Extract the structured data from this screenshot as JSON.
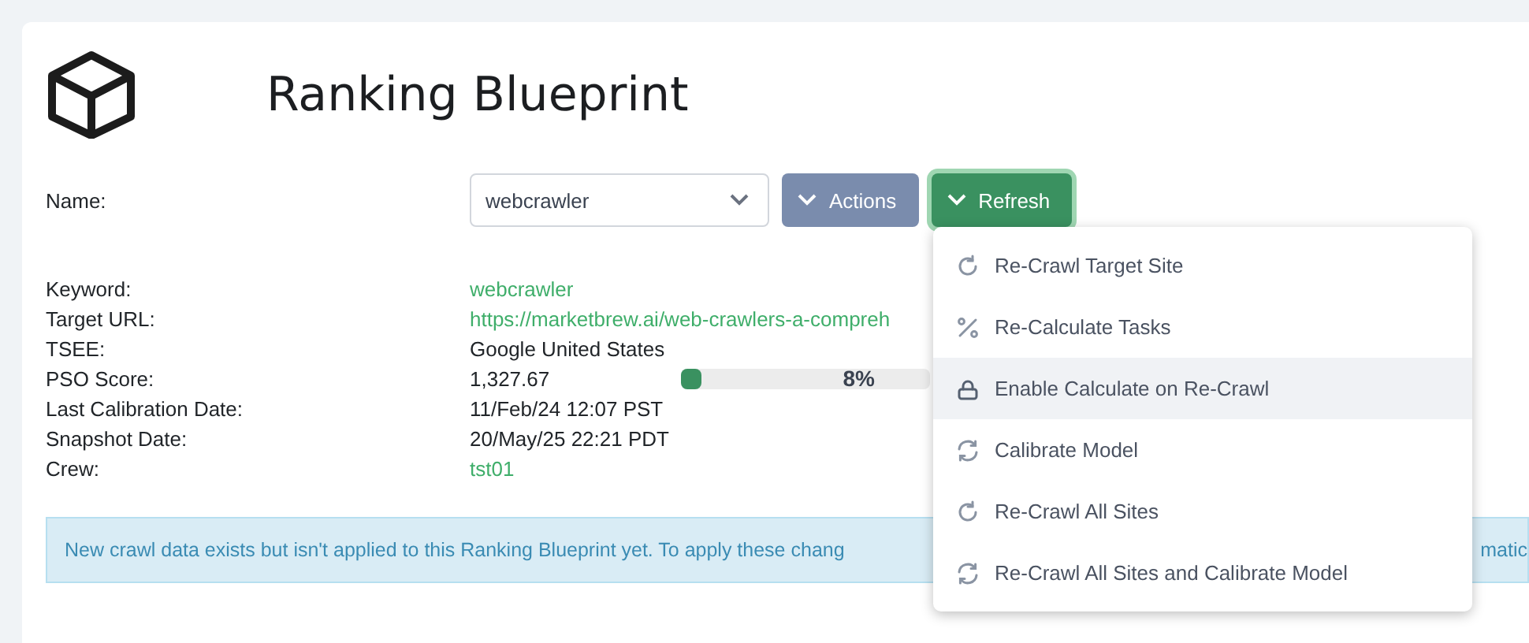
{
  "title": "Ranking Blueprint",
  "name_field": {
    "label": "Name:",
    "value": "webcrawler"
  },
  "buttons": [
    {
      "label": "Actions",
      "kind": "secondary"
    },
    {
      "label": "Refresh",
      "kind": "primary"
    }
  ],
  "details": [
    {
      "label": "Keyword:",
      "value": "webcrawler",
      "kind": "link"
    },
    {
      "label": "Target URL:",
      "value": "https://marketbrew.ai/web-crawlers-a-compreh",
      "kind": "link"
    },
    {
      "label": "TSEE:",
      "value": "Google United States",
      "kind": "text"
    },
    {
      "label": "PSO Score:",
      "value": "1,327.67",
      "kind": "progress",
      "level": 0.08,
      "reading": "8%"
    },
    {
      "label": "Last Calibration Date:",
      "value": "11/Feb/24 12:07 PST",
      "kind": "text"
    },
    {
      "label": "Snapshot Date:",
      "value": "20/May/25 22:21 PDT",
      "kind": "text"
    },
    {
      "label": "Crew:",
      "value": "tst01",
      "kind": "link"
    }
  ],
  "alert": {
    "text_start": "New crawl data exists but isn't applied to this Ranking Blueprint yet. To apply these chang",
    "text_end": "matic"
  },
  "menu": [
    {
      "label": "Re-Crawl Target Site",
      "kind": "rotate",
      "selected": false
    },
    {
      "label": "Re-Calculate Tasks",
      "kind": "percent",
      "selected": false
    },
    {
      "label": "Enable Calculate on Re-Crawl",
      "kind": "lock",
      "selected": true
    },
    {
      "label": "Calibrate Model",
      "kind": "sync",
      "selected": false
    },
    {
      "label": "Re-Crawl All Sites",
      "kind": "rotate",
      "selected": false
    },
    {
      "label": "Re-Crawl All Sites and Calibrate Model",
      "kind": "sync",
      "selected": false
    }
  ]
}
